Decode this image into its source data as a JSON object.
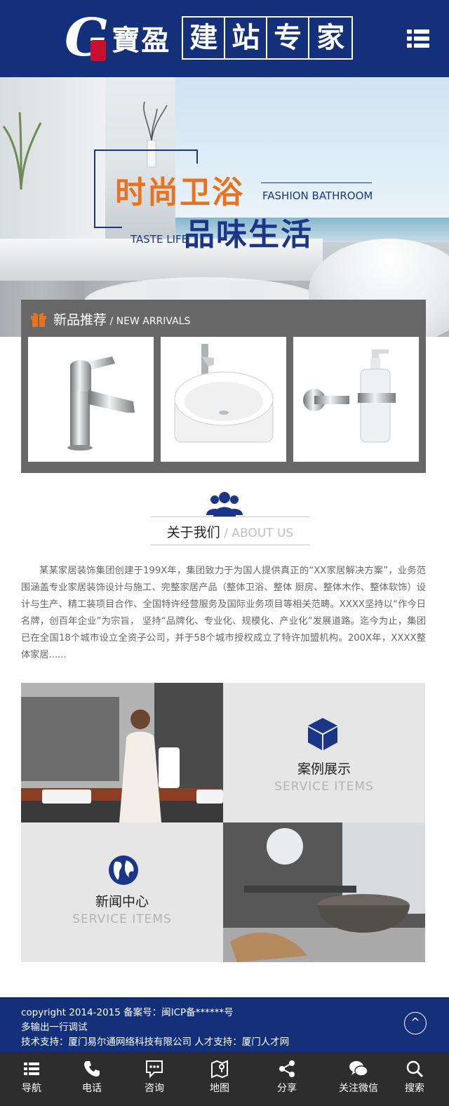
{
  "header": {
    "logo_letter": "G",
    "logo_brand": "寶盈",
    "logo_tagline_chars": [
      "建",
      "站",
      "专",
      "家"
    ],
    "menu_icon": "list-menu-icon"
  },
  "banner": {
    "headline_cn": "时尚卫浴",
    "headline_en": "FASHION BATHROOM",
    "sub_en": "TASTE LIFE",
    "sub_cn": "品味生活"
  },
  "new_arrivals": {
    "icon": "gift-icon",
    "title": "新品推荐",
    "subtitle": " / NEW ARRIVALS",
    "products": [
      "faucet",
      "round-basin",
      "soap-dispenser"
    ]
  },
  "about": {
    "icon": "team-icon",
    "title": "关于我们",
    "title_en": " / ABOUT US",
    "text": "某某家居装饰集团创建于199X年，集团致力于为国人提供真正的“XX家居解决方案”，业务范围涵盖专业家居装饰设计与施工、完整家居产品（整体卫浴、整体 厨房、整体木作、整体软饰）设计与生产、精工装项目合作、全国特许经营服务及国际业务项目等相关范畴。XXXX坚持以“作今日名牌，创百年企业”为宗旨， 坚持“品牌化、专业化、规模化、产业化”发展道路。迄今为止，集团已在全国18个城市设立全资子公司，并于58个城市授权成立了特许加盟机构。200X年，XXXX整体家居......"
  },
  "tiles": {
    "cases": {
      "icon": "cube-icon",
      "title": "案例展示",
      "subtitle": "SERVICE ITEMS"
    },
    "news": {
      "icon": "globe-icon",
      "title": "新闻中心",
      "subtitle": "SERVICE ITEMS"
    }
  },
  "footer": {
    "line1": "copyright 2014-2015 备案号：闽ICP备******号",
    "line2": "多输出一行调试",
    "line3": "技术支持：厦门易尔通网络科技有限公司 人才支持：厦门人才网",
    "top_symbol": "^"
  },
  "nav": [
    {
      "label": "导航",
      "icon": "menu-icon"
    },
    {
      "label": "电话",
      "icon": "phone-icon"
    },
    {
      "label": "咨询",
      "icon": "chat-icon"
    },
    {
      "label": "地图",
      "icon": "map-icon"
    },
    {
      "label": "分享",
      "icon": "share-icon"
    },
    {
      "label": "关注微信",
      "icon": "wechat-icon"
    },
    {
      "label": "搜索",
      "icon": "search-icon"
    }
  ],
  "colors": {
    "brand_blue": "#14307a",
    "accent_orange": "#e8731f",
    "panel_grey": "#676767",
    "nav_dark": "#2d2d2d"
  }
}
